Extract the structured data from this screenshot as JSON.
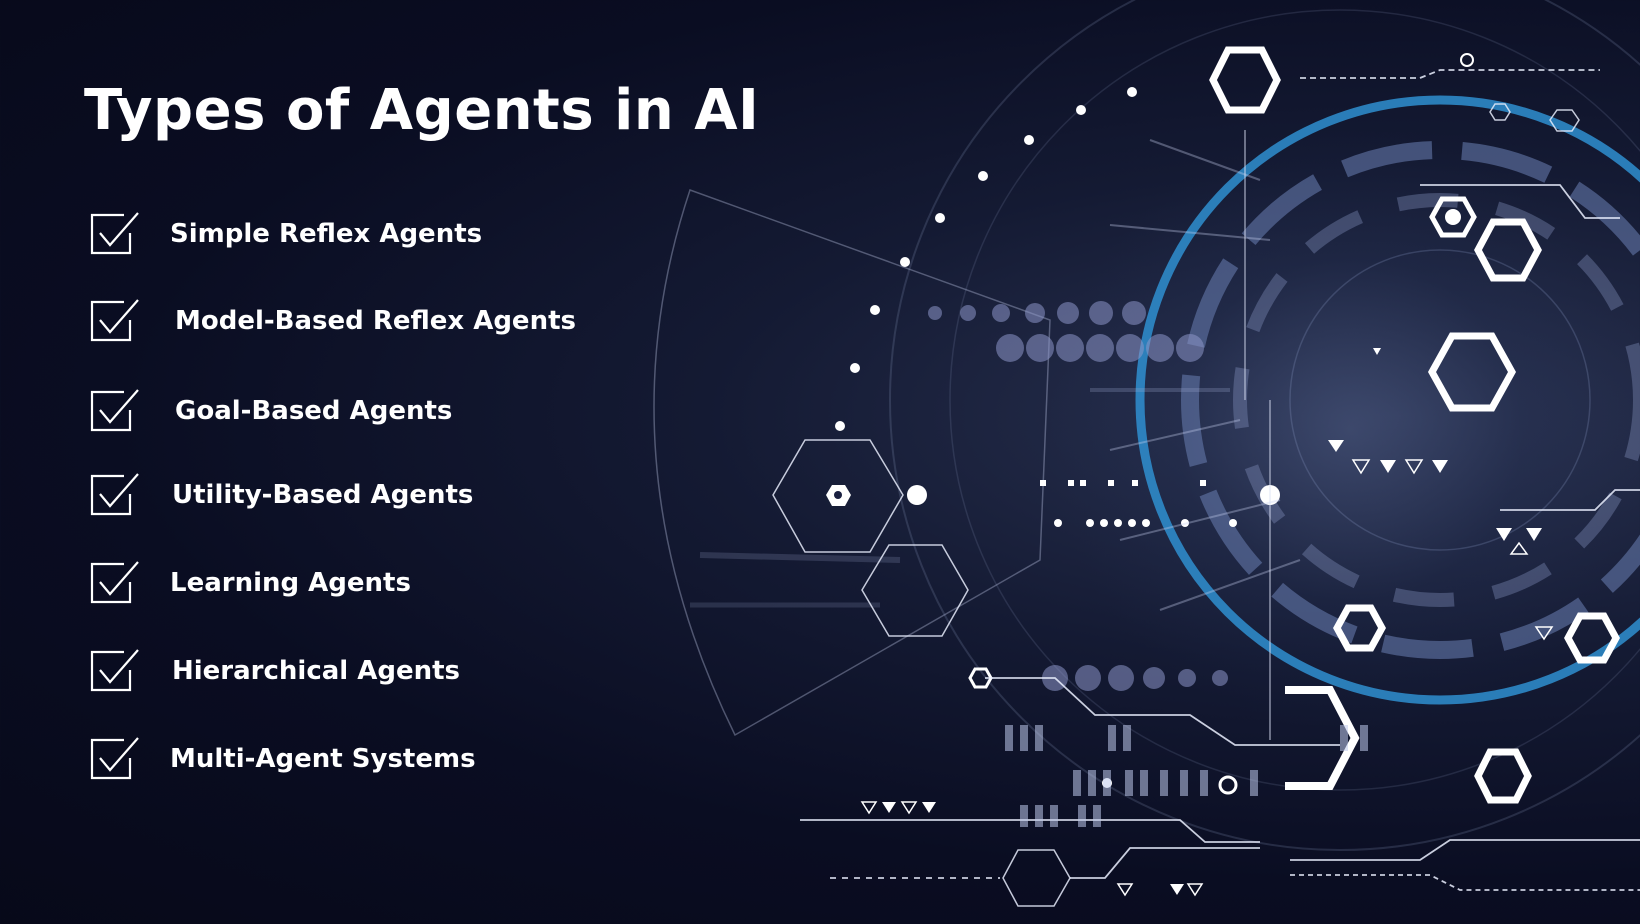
{
  "title": "Types of Agents in AI",
  "items": [
    {
      "label": "Simple Reflex Agents"
    },
    {
      "label": "Model-Based Reflex Agents"
    },
    {
      "label": "Goal-Based Agents"
    },
    {
      "label": "Utility-Based Agents"
    },
    {
      "label": "Learning Agents"
    },
    {
      "label": "Hierarchical Agents"
    },
    {
      "label": "Multi-Agent Systems"
    }
  ],
  "icons": {
    "checkbox": "checkbox-checked-icon"
  },
  "colors": {
    "background": "#0a0d22",
    "text": "#ffffff",
    "accent_ring": "#2f8fd0",
    "hex_outline": "#ffffff"
  }
}
